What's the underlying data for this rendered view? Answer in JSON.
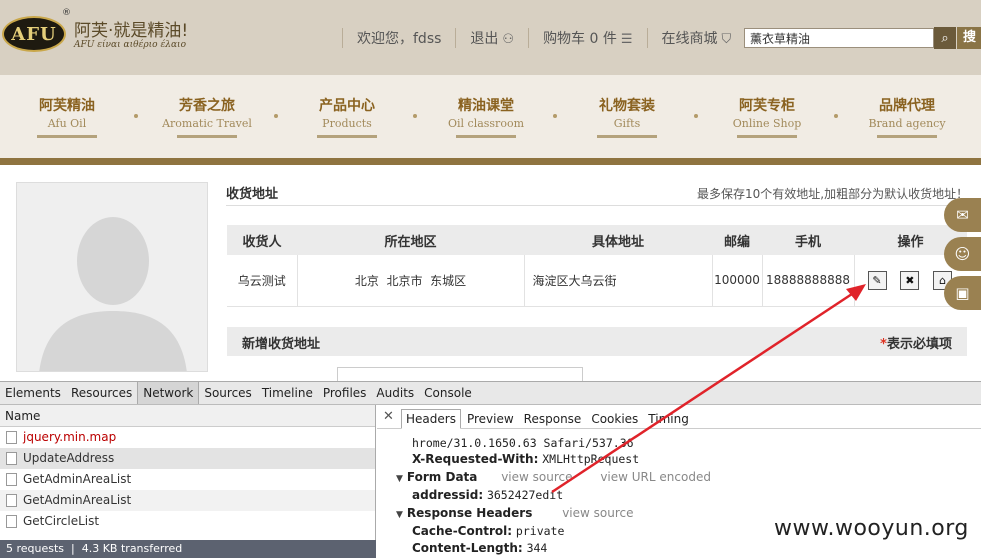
{
  "header": {
    "logo_text": "AFU",
    "slogan": "阿芙·就是精油!",
    "slogan_sub": "AFU είναι αιθέριο έλαιο",
    "welcome": "欢迎您，fdss",
    "logout": "退出",
    "cart": "购物车 0 件",
    "online_store": "在线商城",
    "search_value": "薰衣草精油",
    "search_submit": "搜"
  },
  "nav": [
    {
      "cn": "阿芙精油",
      "en": "Afu Oil"
    },
    {
      "cn": "芳香之旅",
      "en": "Aromatic Travel"
    },
    {
      "cn": "产品中心",
      "en": "Products"
    },
    {
      "cn": "精油课堂",
      "en": "Oil classroom"
    },
    {
      "cn": "礼物套装",
      "en": "Gifts"
    },
    {
      "cn": "阿芙专柜",
      "en": "Online Shop"
    },
    {
      "cn": "品牌代理",
      "en": "Brand agency"
    }
  ],
  "address": {
    "title": "收货地址",
    "note": "最多保存10个有效地址,加粗部分为默认收货地址！",
    "columns": [
      "收货人",
      "所在地区",
      "具体地址",
      "邮编",
      "手机",
      "操作"
    ],
    "rows": [
      {
        "name": "乌云测试",
        "region": "北京  北京市  东城区",
        "street": "海淀区大乌云街",
        "zip": "100000",
        "phone": "18888888888"
      }
    ],
    "new_title": "新增收货地址",
    "required_star": "*",
    "required_text": "表示必填项"
  },
  "devtools": {
    "tabs": [
      "Elements",
      "Resources",
      "Network",
      "Sources",
      "Timeline",
      "Profiles",
      "Audits",
      "Console"
    ],
    "active_tab": "Network",
    "list_header": "Name",
    "requests": [
      "jquery.min.map",
      "UpdateAddress",
      "GetAdminAreaList",
      "GetAdminAreaList",
      "GetCircleList"
    ],
    "status": "5 requests  |  4.3 KB transferred",
    "detail_tabs": [
      "Headers",
      "Preview",
      "Response",
      "Cookies",
      "Timing"
    ],
    "detail": {
      "ua_tail": "hrome/31.0.1650.63 Safari/537.36",
      "xrw_key": "X-Requested-With:",
      "xrw_val": "XMLHttpRequest",
      "form_data": "Form Data",
      "view_source": "view source",
      "view_url_encoded": "view URL encoded",
      "addressid_key": "addressid:",
      "addressid_val": "3652427edit",
      "response_headers": "Response Headers",
      "view_source2": "view source",
      "cache_key": "Cache-Control:",
      "cache_val": "private",
      "length_key": "Content-Length:",
      "length_val": "344"
    }
  },
  "watermark": "www.wooyun.org",
  "colors": {
    "topbar": "#d8d0c2",
    "brand_gold": "#8a6220",
    "annotation_red": "#e0232a"
  }
}
